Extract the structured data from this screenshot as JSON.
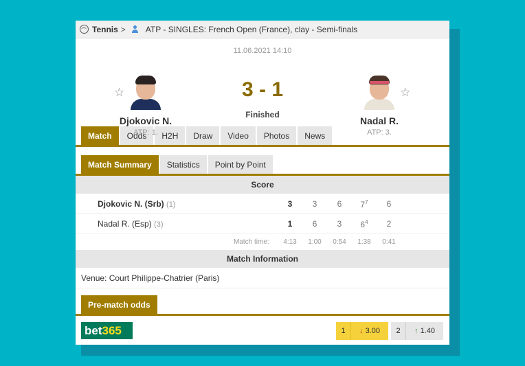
{
  "breadcrumb": {
    "sport": "Tennis",
    "separator": ">",
    "competition": "ATP - SINGLES: French Open (France), clay - Semi-finals"
  },
  "match": {
    "datetime": "11.06.2021 14:10",
    "score": "3 - 1",
    "status": "Finished"
  },
  "home": {
    "name": "Djokovic N.",
    "rank": "ATP: 1."
  },
  "away": {
    "name": "Nadal R.",
    "rank": "ATP: 3."
  },
  "main_tabs": [
    "Match",
    "Odds",
    "H2H",
    "Draw",
    "Video",
    "Photos",
    "News"
  ],
  "sub_tabs": [
    "Match Summary",
    "Statistics",
    "Point by Point"
  ],
  "score_section": {
    "title": "Score",
    "rows": [
      {
        "player": "Djokovic N. (Srb)",
        "seed": "(1)",
        "total": "3",
        "sets": [
          "3",
          "6",
          "7",
          "6"
        ],
        "tb": [
          "",
          "",
          "7",
          ""
        ]
      },
      {
        "player": "Nadal R. (Esp)",
        "seed": "(3)",
        "total": "1",
        "sets": [
          "6",
          "3",
          "6",
          "2"
        ],
        "tb": [
          "",
          "",
          "4",
          ""
        ]
      }
    ],
    "match_time_label": "Match time:",
    "match_time": "4:13",
    "set_times": [
      "1:00",
      "0:54",
      "1:38",
      "0:41"
    ]
  },
  "match_info": {
    "title": "Match Information",
    "venue": "Venue: Court Philippe-Chatrier (Paris)"
  },
  "odds": {
    "tab_label": "Pre-match odds",
    "bookmaker": {
      "prefix": "bet",
      "suffix": "365"
    },
    "home_key": "1",
    "home_value": "3.00",
    "home_trend": "down",
    "away_key": "2",
    "away_value": "1.40",
    "away_trend": "up"
  },
  "colors": {
    "accent": "#a07d00",
    "background": "#00b3c7",
    "bet365": "#027b5b"
  }
}
